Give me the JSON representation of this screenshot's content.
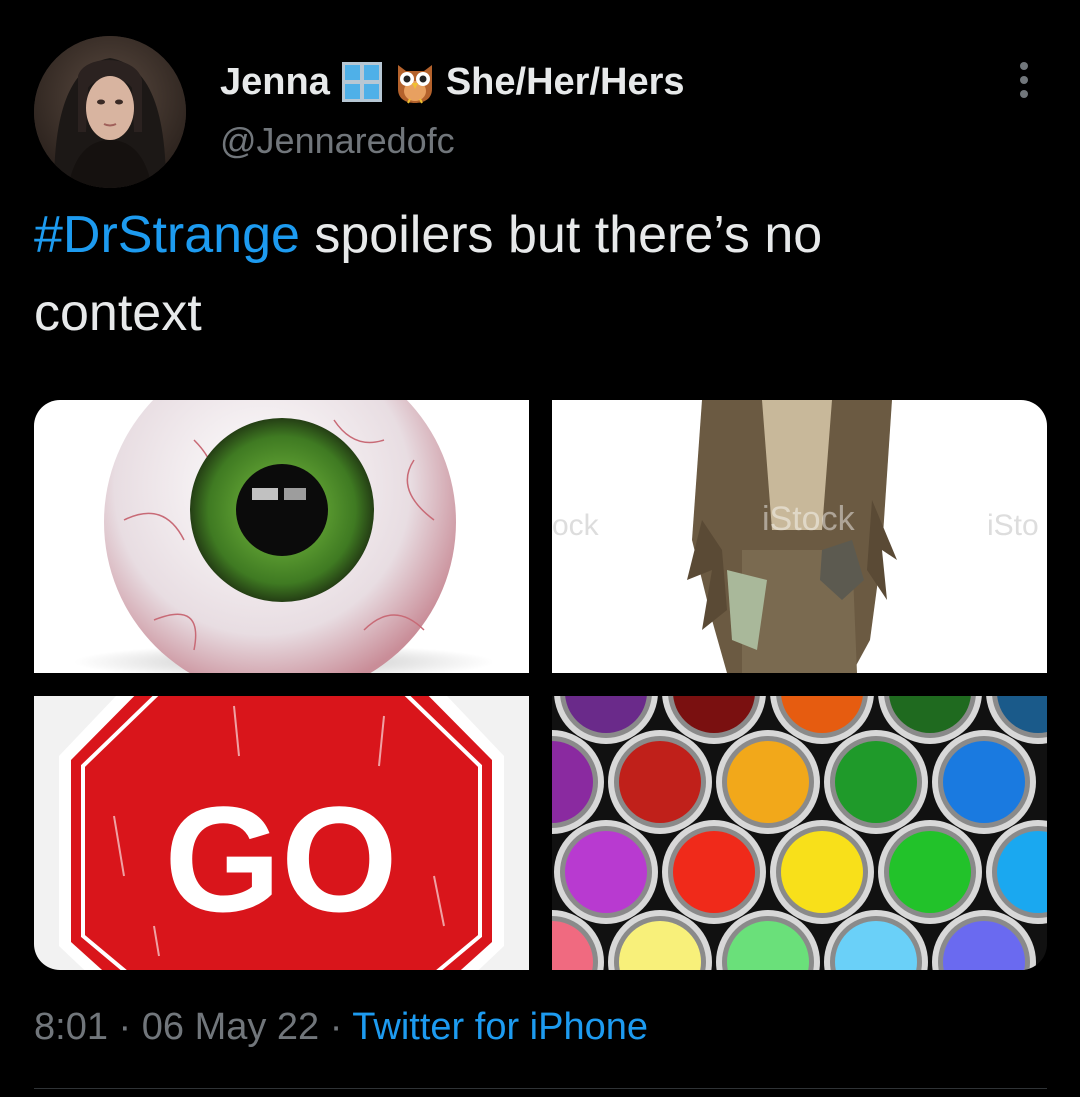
{
  "tweet": {
    "author": {
      "name": "Jenna",
      "pronouns": "She/Her/Hers",
      "handle": "@Jennaredofc",
      "name_emojis": [
        "window-emoji",
        "owl-emoji"
      ]
    },
    "text": {
      "hashtag": "#DrStrange",
      "body_line1": " spoilers but there’s no",
      "body_line2": "context"
    },
    "media": [
      {
        "name": "eyeball-image"
      },
      {
        "name": "zombie-costume-image"
      },
      {
        "name": "go-stop-sign-image",
        "sign_text": "GO"
      },
      {
        "name": "paint-cans-image"
      }
    ],
    "meta": {
      "time": "8:01",
      "separator": " · ",
      "date": "06 May 22",
      "source": "Twitter for iPhone"
    }
  },
  "colors": {
    "background": "#000000",
    "text": "#e7e9ea",
    "secondary_text": "#71767b",
    "accent": "#1d9bf0"
  }
}
